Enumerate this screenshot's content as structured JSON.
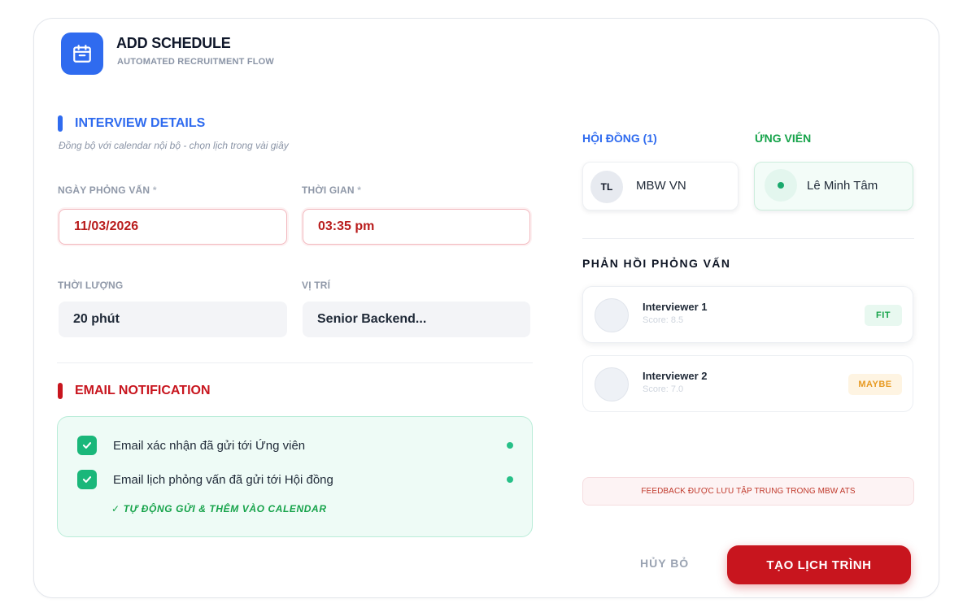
{
  "header": {
    "title": "ADD SCHEDULE",
    "subtitle": "AUTOMATED RECRUITMENT FLOW",
    "logo_icon": "calendar-icon"
  },
  "interview": {
    "section_title": "INTERVIEW DETAILS",
    "section_desc": "Đồng bộ với calendar nội bộ - chọn lịch trong vài giây",
    "date_label": "NGÀY PHỎNG VẤN",
    "date_value": "11/03/2026",
    "time_label": "THỜI GIAN",
    "time_value": "03:35 pm",
    "required_mark": "*",
    "duration_label": "THỜI LƯỢNG",
    "duration_value": "20 phút",
    "position_label": "VỊ TRÍ",
    "position_value": "Senior Backend..."
  },
  "email": {
    "section_title": "EMAIL NOTIFICATION",
    "items": [
      {
        "label": "Email xác nhận đã gửi tới Ứng viên",
        "checked": true
      },
      {
        "label": "Email lịch phỏng vấn đã gửi tới Hội đồng",
        "checked": true
      }
    ],
    "auto_note": "✓ TỰ ĐỘNG GỬI & THÊM VÀO CALENDAR"
  },
  "panel": {
    "council_label": "HỘI ĐỒNG (1)",
    "candidate_label": "ỨNG VIÊN",
    "council_member": {
      "initials": "TL",
      "name": "MBW VN"
    },
    "candidate": {
      "name": "Lê Minh Tâm"
    }
  },
  "feedback": {
    "title": "PHẢN HỒI PHỎNG VẤN",
    "items": [
      {
        "name": "Interviewer 1",
        "score": "Score: 8.5",
        "badge": "FIT"
      },
      {
        "name": "Interviewer 2",
        "score": "Score: 7.0",
        "badge": "MAYBE"
      }
    ],
    "saved_note": "FEEDBACK ĐƯỢC LƯU TẬP TRUNG TRONG MBW ATS"
  },
  "actions": {
    "cancel": "HỦY BỎ",
    "create": "TẠO LỊCH TRÌNH"
  },
  "colors": {
    "brand_blue": "#2f6bef",
    "accent_red": "#c8151e",
    "success_green": "#1ab77a"
  }
}
